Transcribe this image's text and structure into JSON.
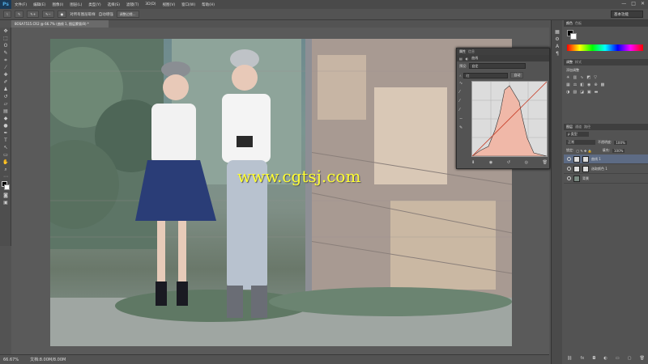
{
  "app": {
    "logo": "Ps"
  },
  "menu": [
    "文件(F)",
    "编辑(E)",
    "图像(I)",
    "图层(L)",
    "类型(Y)",
    "选择(S)",
    "滤镜(T)",
    "3D(D)",
    "视图(V)",
    "窗口(W)",
    "帮助(H)"
  ],
  "window_controls": [
    "—",
    "□",
    "✕"
  ],
  "options": {
    "sample_all_layers": "对所有图层取样",
    "auto_enhance": "自动增强",
    "refine_edge": "调整边缘...",
    "workspace": "基本功能"
  },
  "document": {
    "tab_title": "8OSA7515.CR2 @ 66.7% (曲线 1, 图层蒙版/8) *",
    "zoom": "66.67%",
    "doc_size": "文档:8.00M/8.00M"
  },
  "curves_panel": {
    "tabs": [
      "属性",
      "信息"
    ],
    "title": "曲线",
    "preset_label": "预设:",
    "preset_value": "自定",
    "channel_value": "红",
    "auto_label": "自动"
  },
  "swatches_panel": {
    "tabs": [
      "颜色",
      "色板"
    ]
  },
  "adjustments_panel": {
    "tabs": [
      "调整",
      "样式"
    ],
    "title": "添加调整"
  },
  "layers_panel": {
    "tabs": [
      "图层",
      "通道",
      "路径"
    ],
    "kind_label": "ρ 类型",
    "blend_mode": "正常",
    "opacity_label": "不透明度:",
    "opacity_value": "100%",
    "lock_label": "锁定:",
    "fill_label": "填充:",
    "fill_value": "100%",
    "layers": [
      {
        "name": "曲线 1",
        "selected": true
      },
      {
        "name": "选取颜色 1",
        "selected": false
      },
      {
        "name": "背景",
        "selected": false
      }
    ]
  },
  "watermark": "www.cgtsj.com",
  "colors": {
    "accent_select": "#5d6b84",
    "watermark": "#ffff33",
    "histogram": "#f0b8a8"
  }
}
